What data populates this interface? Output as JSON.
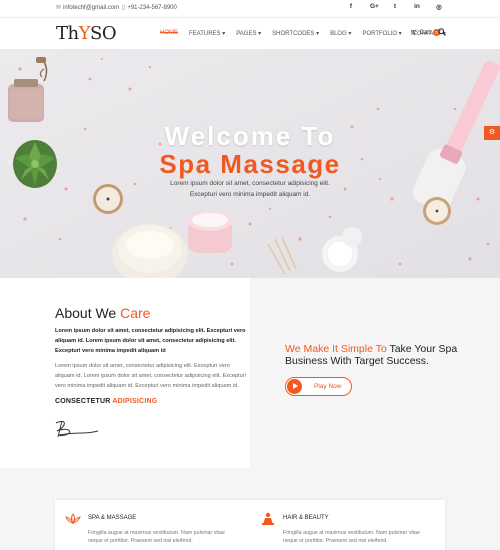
{
  "topbar": {
    "email": "infotechf@gmail.com",
    "phone": "+91-234-567-8900",
    "social_icons": [
      "facebook-icon",
      "google-plus-icon",
      "twitter-icon",
      "linkedin-icon",
      "instagram-icon"
    ],
    "social_glyphs": [
      "f",
      "G+",
      "t",
      "in",
      "◎"
    ]
  },
  "nav": {
    "logo_prefix": "Th",
    "logo_mark": "Y",
    "logo_suffix": "SO",
    "items": [
      "HOME",
      "FEATURES ▾",
      "PAGES ▾",
      "SHORTCODES ▾",
      "BLOG ▾",
      "PORTFOLIO ▾",
      "CONTACT ▾"
    ],
    "cart_label": "Cart",
    "cart_count": "0"
  },
  "hero": {
    "title_line1": "Welcome To",
    "title_line2": "Spa Massage",
    "subtitle_line1": "Lorem ipsum dolor sit amet, consectetur adipisicing elit.",
    "subtitle_line2": "Excepturi vero minima impedit aliquam id."
  },
  "about": {
    "title_prefix": "About We ",
    "title_accent": "Care",
    "bold_text": "Lorem ipsum dolor sit amet, consectetur adipisicing elit. Excepturi vero aliquam id. Lorem ipsum dolor sit amet, consectetur adipisicing elit. Excepturi vero minima impedit aliquam id",
    "body_text": "Lorem ipsum dolor sit amet, consectetur adipisicing elit. Excepturi vero aliquam id. Lorem ipsum dolor sit amet, consectetur adipisicing elit. Excepturi vero minima impedit aliquam id. Excepturi vero minima impedit aliquam id.",
    "consectetur": "CONSECTETUR ",
    "adipisicing": "ADIPISICING"
  },
  "promo": {
    "heading_accent": "We Make It Simple To",
    "heading_rest": " Take Your Spa Business With Target Success.",
    "button_label": "Play Now"
  },
  "services": [
    {
      "icon": "lotus-icon",
      "title": "SPA & MASSAGE",
      "text": "Fringilla augue at maximus vestibulum. Nam pulvinar vitae neque et porttitor. Praesent sed nisi eleifend."
    },
    {
      "icon": "spa-person-icon",
      "title": "HAIR & BEAUTY",
      "text": "Fringilla augue at maximus vestibulum. Nam pulvinar vitae neque et porttitor. Praesent sed nisi eleifend."
    }
  ],
  "colors": {
    "accent": "#f05a22",
    "hero_bg": "#ebe9ec",
    "panel_bg": "#f5f5f5"
  }
}
